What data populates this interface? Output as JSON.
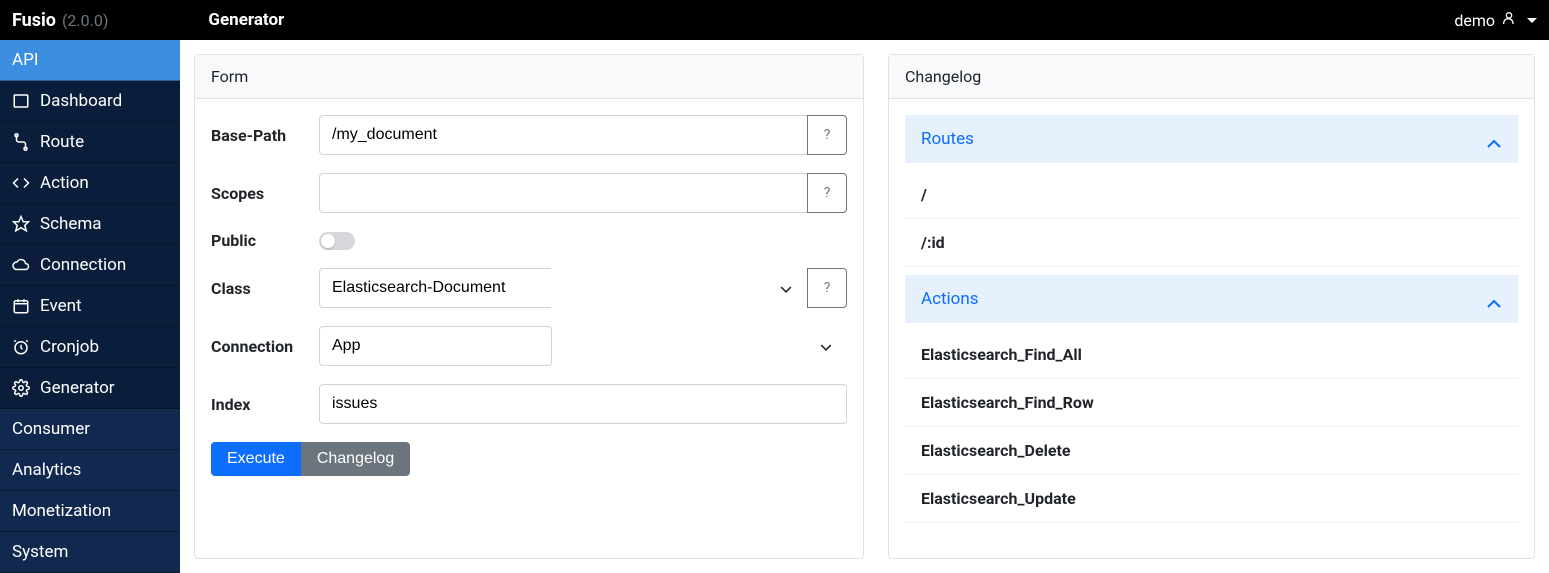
{
  "brand": {
    "name": "Fusio",
    "version": "(2.0.0)"
  },
  "page_title": "Generator",
  "user": {
    "name": "demo"
  },
  "sidebar": {
    "groups": [
      {
        "type": "active",
        "label": "API"
      },
      {
        "type": "item",
        "icon": "dashboard",
        "label": "Dashboard"
      },
      {
        "type": "item",
        "icon": "route",
        "label": "Route"
      },
      {
        "type": "item",
        "icon": "code",
        "label": "Action"
      },
      {
        "type": "item",
        "icon": "star",
        "label": "Schema"
      },
      {
        "type": "item",
        "icon": "cloud",
        "label": "Connection"
      },
      {
        "type": "item",
        "icon": "calendar",
        "label": "Event"
      },
      {
        "type": "item",
        "icon": "clock",
        "label": "Cronjob"
      },
      {
        "type": "item",
        "icon": "gear",
        "label": "Generator"
      },
      {
        "type": "section",
        "label": "Consumer"
      },
      {
        "type": "section",
        "label": "Analytics"
      },
      {
        "type": "section",
        "label": "Monetization"
      },
      {
        "type": "section",
        "label": "System"
      }
    ]
  },
  "form": {
    "title": "Form",
    "base_path": {
      "label": "Base-Path",
      "value": "/my_document",
      "help": "?"
    },
    "scopes": {
      "label": "Scopes",
      "value": "",
      "help": "?"
    },
    "public_": {
      "label": "Public",
      "value": false
    },
    "class_": {
      "label": "Class",
      "value": "Elasticsearch-Document",
      "help": "?"
    },
    "connection": {
      "label": "Connection",
      "value": "App"
    },
    "index_": {
      "label": "Index",
      "value": "issues"
    },
    "buttons": {
      "execute": "Execute",
      "changelog": "Changelog"
    }
  },
  "changelog": {
    "title": "Changelog",
    "routes": {
      "title": "Routes",
      "items": [
        "/",
        "/:id"
      ]
    },
    "actions": {
      "title": "Actions",
      "items": [
        "Elasticsearch_Find_All",
        "Elasticsearch_Find_Row",
        "Elasticsearch_Delete",
        "Elasticsearch_Update"
      ]
    }
  }
}
